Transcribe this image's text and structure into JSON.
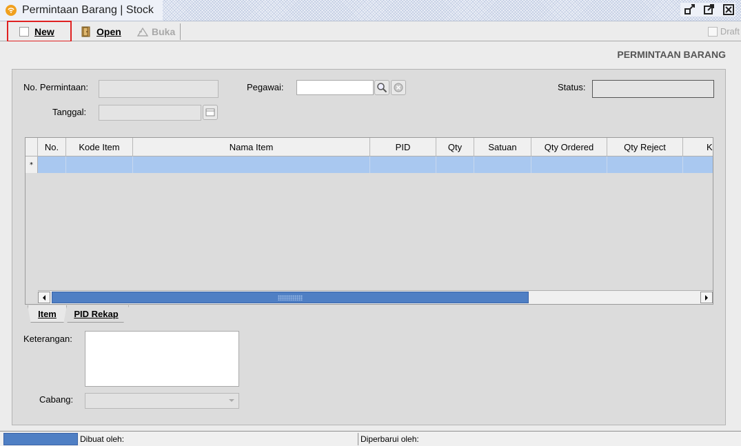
{
  "window": {
    "title": "Permintaan Barang | Stock"
  },
  "toolbar": {
    "new_label": "New",
    "open_label": "Open",
    "buka_label": "Buka",
    "draft_label": "Draft"
  },
  "form": {
    "header": "PERMINTAAN BARANG",
    "no_permintaan_label": "No. Permintaan:",
    "tanggal_label": "Tanggal:",
    "pegawai_label": "Pegawai:",
    "status_label": "Status:",
    "keterangan_label": "Keterangan:",
    "cabang_label": "Cabang:"
  },
  "grid": {
    "row_marker": "*",
    "columns": [
      "No.",
      "Kode Item",
      "Nama Item",
      "PID",
      "Qty",
      "Satuan",
      "Qty Ordered",
      "Qty Reject",
      "K"
    ]
  },
  "tabs": [
    "Item",
    "PID Rekap"
  ],
  "statusbar": {
    "dibuat_label": "Dibuat oleh:",
    "diperbarui_label": "Diperbarui oleh:"
  },
  "icons": {
    "title": "rss-app-icon",
    "open": "door-icon",
    "buka": "unlock-icon",
    "search": "magnifier-icon",
    "clear": "clear-icon",
    "calendar": "calendar-icon",
    "minimize": "restore-icon",
    "maximize": "maximize-icon",
    "close": "close-icon"
  },
  "colors": {
    "selected_row": "#a9c8f0",
    "scroll_thumb": "#4f7fc4",
    "highlight_border": "#e02020"
  }
}
